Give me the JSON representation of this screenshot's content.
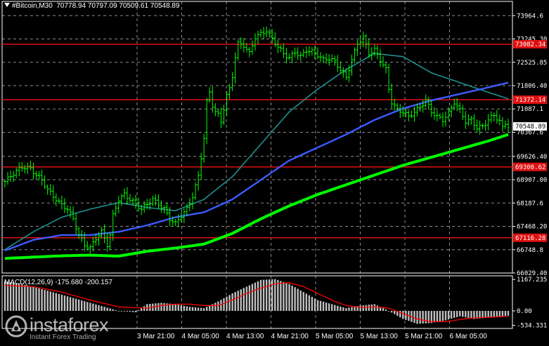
{
  "header": {
    "symbol": "#Bitcoin,M30",
    "ohlc": "70778.94 70797.09 70509.61 70548.89"
  },
  "macd_header": "MACD(12,26,9) -175.680 -200.157",
  "watermark": {
    "brand": "instaforex",
    "tagline": "Instant Forex Trading"
  },
  "colors": {
    "background": "#000000",
    "grid": "#ffffff",
    "candle": "#00ff00",
    "sma_fast": "#1f8f8f",
    "sma_mid": "#3c5cff",
    "sma_slow": "#00ff00",
    "level_line": "#e01010",
    "macd_hist": "#c0c0c0",
    "macd_signal": "#ff0000"
  },
  "chart_data": [
    {
      "type": "candlestick",
      "symbol": "#Bitcoin",
      "timeframe": "M30",
      "x_tick_labels": [
        "3 Mar 21:00",
        "4 Mar 05:00",
        "4 Mar 13:00",
        "4 Mar 21:00",
        "5 Mar 05:00",
        "5 Mar 13:00",
        "5 Mar 21:00",
        "6 Mar 05:00"
      ],
      "y_tick_labels": [
        "73964.6",
        "73245.30",
        "72525.85",
        "71806.40",
        "71087.1",
        "70367.6",
        "69626.40",
        "68907.00",
        "68187.6",
        "67468.20",
        "66748.8",
        "66029.40"
      ],
      "ylim": [
        66029.4,
        74100
      ],
      "current_price": "70548.89",
      "horizontal_levels": [
        {
          "label": "73082.34",
          "value": 73082.34
        },
        {
          "label": "71372.14",
          "value": 71372.14
        },
        {
          "label": "69300.62",
          "value": 69300.62
        },
        {
          "label": "67116.28",
          "value": 67116.28
        }
      ],
      "close_path": [
        [
          0,
          68850
        ],
        [
          3,
          69100
        ],
        [
          6,
          69300
        ],
        [
          9,
          69250
        ],
        [
          11,
          69050
        ],
        [
          13,
          68900
        ],
        [
          15,
          68600
        ],
        [
          17,
          68400
        ],
        [
          19,
          68200
        ],
        [
          22,
          68000
        ],
        [
          24,
          67700
        ],
        [
          26,
          67200
        ],
        [
          28,
          66900
        ],
        [
          30,
          66800
        ],
        [
          32,
          67100
        ],
        [
          34,
          67300
        ],
        [
          36,
          66900
        ],
        [
          37,
          67200
        ],
        [
          38,
          67800
        ],
        [
          40,
          68300
        ],
        [
          42,
          68450
        ],
        [
          44,
          68300
        ],
        [
          46,
          68150
        ],
        [
          48,
          68000
        ],
        [
          50,
          68150
        ],
        [
          52,
          68300
        ],
        [
          54,
          68150
        ],
        [
          56,
          68000
        ],
        [
          58,
          67700
        ],
        [
          60,
          67550
        ],
        [
          62,
          67800
        ],
        [
          64,
          68000
        ],
        [
          66,
          68400
        ],
        [
          68,
          69000
        ],
        [
          70,
          70200
        ],
        [
          71,
          71300
        ],
        [
          72,
          71600
        ],
        [
          73,
          71200
        ],
        [
          74,
          71000
        ],
        [
          75,
          70900
        ],
        [
          76,
          70700
        ],
        [
          77,
          71100
        ],
        [
          78,
          71500
        ],
        [
          79,
          71700
        ],
        [
          80,
          72100
        ],
        [
          81,
          72700
        ],
        [
          82,
          73100
        ],
        [
          84,
          73050
        ],
        [
          86,
          72800
        ],
        [
          88,
          73300
        ],
        [
          90,
          73400
        ],
        [
          92,
          73500
        ],
        [
          94,
          73250
        ],
        [
          96,
          73000
        ],
        [
          98,
          72800
        ],
        [
          100,
          72650
        ],
        [
          102,
          72850
        ],
        [
          104,
          72700
        ],
        [
          106,
          72900
        ],
        [
          108,
          72850
        ],
        [
          110,
          72750
        ],
        [
          112,
          72600
        ],
        [
          114,
          72650
        ],
        [
          116,
          72550
        ],
        [
          118,
          72300
        ],
        [
          120,
          72050
        ],
        [
          122,
          72600
        ],
        [
          124,
          73100
        ],
        [
          126,
          73300
        ],
        [
          127,
          73050
        ],
        [
          128,
          72800
        ],
        [
          130,
          72900
        ],
        [
          132,
          72600
        ],
        [
          134,
          72300
        ],
        [
          135,
          71700
        ],
        [
          136,
          71300
        ],
        [
          138,
          71050
        ],
        [
          140,
          71000
        ],
        [
          142,
          70850
        ],
        [
          144,
          71000
        ],
        [
          146,
          71150
        ],
        [
          148,
          71350
        ],
        [
          150,
          71000
        ],
        [
          152,
          70850
        ],
        [
          154,
          70750
        ],
        [
          156,
          70950
        ],
        [
          158,
          71300
        ],
        [
          160,
          71050
        ],
        [
          162,
          70700
        ],
        [
          164,
          70750
        ],
        [
          166,
          70500
        ],
        [
          168,
          70550
        ],
        [
          170,
          70750
        ],
        [
          172,
          70900
        ],
        [
          174,
          70700
        ],
        [
          175,
          70500
        ],
        [
          176,
          70650
        ],
        [
          177,
          70548.89
        ]
      ],
      "sma_fast_path": [
        [
          0,
          66750
        ],
        [
          10,
          67300
        ],
        [
          20,
          67750
        ],
        [
          30,
          68000
        ],
        [
          40,
          68200
        ],
        [
          50,
          68050
        ],
        [
          60,
          67950
        ],
        [
          70,
          68300
        ],
        [
          80,
          69000
        ],
        [
          90,
          70000
        ],
        [
          100,
          71000
        ],
        [
          110,
          71700
        ],
        [
          120,
          72300
        ],
        [
          130,
          72800
        ],
        [
          140,
          72700
        ],
        [
          150,
          72200
        ],
        [
          160,
          71900
        ],
        [
          170,
          71600
        ],
        [
          177,
          71400
        ]
      ],
      "sma_mid_path": [
        [
          0,
          66720
        ],
        [
          10,
          67050
        ],
        [
          20,
          67200
        ],
        [
          30,
          67200
        ],
        [
          40,
          67300
        ],
        [
          50,
          67500
        ],
        [
          60,
          67750
        ],
        [
          70,
          67900
        ],
        [
          80,
          68300
        ],
        [
          90,
          68900
        ],
        [
          100,
          69500
        ],
        [
          110,
          69900
        ],
        [
          120,
          70300
        ],
        [
          130,
          70750
        ],
        [
          140,
          71100
        ],
        [
          150,
          71350
        ],
        [
          160,
          71550
        ],
        [
          170,
          71750
        ],
        [
          177,
          71900
        ]
      ],
      "sma_slow_path": [
        [
          0,
          66480
        ],
        [
          10,
          66520
        ],
        [
          20,
          66560
        ],
        [
          30,
          66580
        ],
        [
          40,
          66550
        ],
        [
          50,
          66700
        ],
        [
          60,
          66800
        ],
        [
          70,
          66920
        ],
        [
          80,
          67250
        ],
        [
          90,
          67700
        ],
        [
          100,
          68100
        ],
        [
          110,
          68450
        ],
        [
          120,
          68750
        ],
        [
          130,
          69050
        ],
        [
          140,
          69350
        ],
        [
          150,
          69600
        ],
        [
          160,
          69850
        ],
        [
          170,
          70100
        ],
        [
          177,
          70300
        ]
      ]
    },
    {
      "type": "bar",
      "name": "MACD(12,26,9)",
      "main_value": "-175.680",
      "signal_value": "-200.157",
      "y_tick_labels": [
        "1167.235",
        "0.00",
        "-534.331"
      ],
      "ylim": [
        -600,
        1250
      ],
      "histogram_path": [
        [
          0,
          1100
        ],
        [
          10,
          900
        ],
        [
          20,
          600
        ],
        [
          30,
          300
        ],
        [
          40,
          0
        ],
        [
          46,
          -50
        ],
        [
          50,
          250
        ],
        [
          55,
          300
        ],
        [
          60,
          250
        ],
        [
          65,
          150
        ],
        [
          70,
          100
        ],
        [
          75,
          350
        ],
        [
          80,
          650
        ],
        [
          85,
          900
        ],
        [
          90,
          1150
        ],
        [
          95,
          1180
        ],
        [
          100,
          1000
        ],
        [
          105,
          700
        ],
        [
          110,
          400
        ],
        [
          115,
          250
        ],
        [
          120,
          100
        ],
        [
          125,
          200
        ],
        [
          130,
          250
        ],
        [
          135,
          0
        ],
        [
          140,
          -300
        ],
        [
          145,
          -480
        ],
        [
          150,
          -450
        ],
        [
          155,
          -350
        ],
        [
          160,
          -200
        ],
        [
          165,
          -300
        ],
        [
          170,
          -250
        ],
        [
          177,
          -175
        ]
      ],
      "signal_path": [
        [
          0,
          950
        ],
        [
          10,
          900
        ],
        [
          20,
          700
        ],
        [
          30,
          400
        ],
        [
          40,
          150
        ],
        [
          50,
          100
        ],
        [
          55,
          200
        ],
        [
          60,
          250
        ],
        [
          65,
          250
        ],
        [
          70,
          200
        ],
        [
          75,
          200
        ],
        [
          80,
          400
        ],
        [
          85,
          650
        ],
        [
          90,
          850
        ],
        [
          95,
          1000
        ],
        [
          100,
          1050
        ],
        [
          105,
          900
        ],
        [
          110,
          650
        ],
        [
          115,
          400
        ],
        [
          120,
          200
        ],
        [
          125,
          130
        ],
        [
          130,
          150
        ],
        [
          135,
          100
        ],
        [
          140,
          -100
        ],
        [
          145,
          -300
        ],
        [
          150,
          -400
        ],
        [
          155,
          -400
        ],
        [
          160,
          -320
        ],
        [
          165,
          -260
        ],
        [
          170,
          -240
        ],
        [
          177,
          -200
        ]
      ]
    }
  ]
}
